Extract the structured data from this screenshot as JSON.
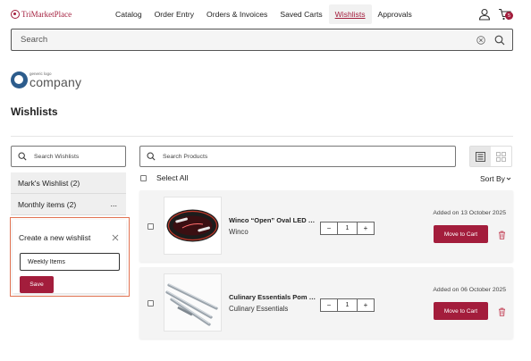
{
  "header": {
    "brand": "TriMarketPlace",
    "nav": [
      {
        "label": "Catalog"
      },
      {
        "label": "Order Entry"
      },
      {
        "label": "Orders & Invoices"
      },
      {
        "label": "Saved Carts"
      },
      {
        "label": "Wishlists",
        "active": true
      },
      {
        "label": "Approvals"
      }
    ],
    "cart_count": "5"
  },
  "search": {
    "placeholder": "Search"
  },
  "company": {
    "small_text": "generic logo",
    "name": "company"
  },
  "page": {
    "title": "Wishlists"
  },
  "wishlists": {
    "search_placeholder": "Search Wishlists",
    "items": [
      {
        "label": "Mark's Wishlist (2)",
        "more": ""
      },
      {
        "label": "Monthly items (2)",
        "more": "..."
      }
    ],
    "create": {
      "title": "Create a new wishlist",
      "input_value": "Weekly Items",
      "save_label": "Save"
    }
  },
  "products": {
    "search_placeholder": "Search Products",
    "select_all_label": "Select All",
    "sort_label": "Sort By",
    "items": [
      {
        "name": "Winco “Open” Oval LED Sign",
        "brand": "Winco",
        "quantity": "1",
        "added_on": "Added on 13 October 2025",
        "move_label": "Move to Cart",
        "icon": "open-sign"
      },
      {
        "name": "Culinary Essentials Pom Pom",
        "brand": "Culinary Essentials",
        "quantity": "1",
        "added_on": "Added on 06 October 2025",
        "move_label": "Move to Cart",
        "icon": "metal-rods"
      }
    ]
  },
  "colors": {
    "brand": "#a31d3c",
    "highlight": "#e27352"
  }
}
